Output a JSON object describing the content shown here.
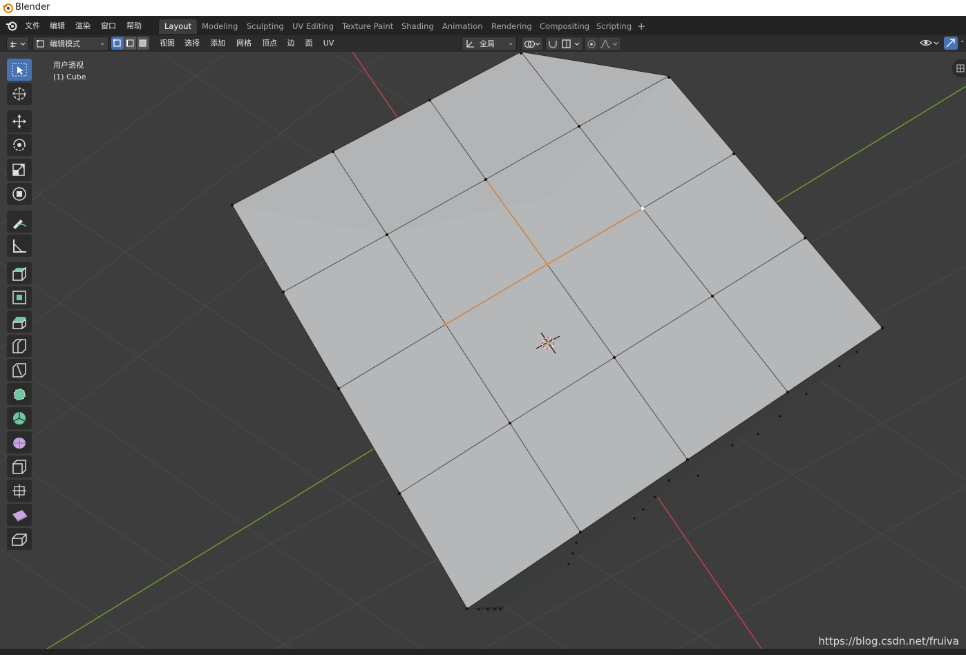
{
  "titlebar": {
    "title": "Blender"
  },
  "menu": [
    "文件",
    "编辑",
    "渲染",
    "窗口",
    "帮助"
  ],
  "workspaces": [
    "Layout",
    "Modeling",
    "Sculpting",
    "UV Editing",
    "Texture Paint",
    "Shading",
    "Animation",
    "Rendering",
    "Compositing",
    "Scripting"
  ],
  "active_workspace": "Layout",
  "add_tab_label": "+",
  "header": {
    "mode": "编辑模式",
    "menus": [
      "视图",
      "选择",
      "添加",
      "网格",
      "顶点",
      "边",
      "面",
      "UV"
    ],
    "transform_orientation": "全局"
  },
  "overlay": {
    "view_name": "用户透视",
    "object_name": "(1) Cube"
  },
  "tools": [
    {
      "name": "select-box-icon",
      "active": true
    },
    {
      "name": "cursor-icon",
      "active": false
    },
    {
      "name": "move-icon",
      "active": false
    },
    {
      "name": "rotate-icon",
      "active": false
    },
    {
      "name": "scale-icon",
      "active": false
    },
    {
      "name": "transform-icon",
      "active": false
    },
    {
      "name": "annotate-icon",
      "active": false
    },
    {
      "name": "measure-icon",
      "active": false
    },
    {
      "name": "extrude-region-icon",
      "active": false
    },
    {
      "name": "inset-faces-icon",
      "active": false
    },
    {
      "name": "bevel-icon",
      "active": false
    },
    {
      "name": "loop-cut-icon",
      "active": false
    },
    {
      "name": "knife-icon",
      "active": false
    },
    {
      "name": "poly-build-icon",
      "active": false
    },
    {
      "name": "spin-icon",
      "active": false
    },
    {
      "name": "smooth-icon",
      "active": false
    },
    {
      "name": "edge-slide-icon",
      "active": false
    },
    {
      "name": "shrink-fatten-icon",
      "active": false
    },
    {
      "name": "shear-icon",
      "active": false
    },
    {
      "name": "rip-region-icon",
      "active": false
    }
  ],
  "watermark": "https://blog.csdn.net/fruiva",
  "colors": {
    "accent": "#4772b3",
    "x_axis": "#c2404f",
    "y_axis": "#6e9a2b",
    "selected_edge": "#e07a1f",
    "mesh_face": "#b5b7b9"
  }
}
